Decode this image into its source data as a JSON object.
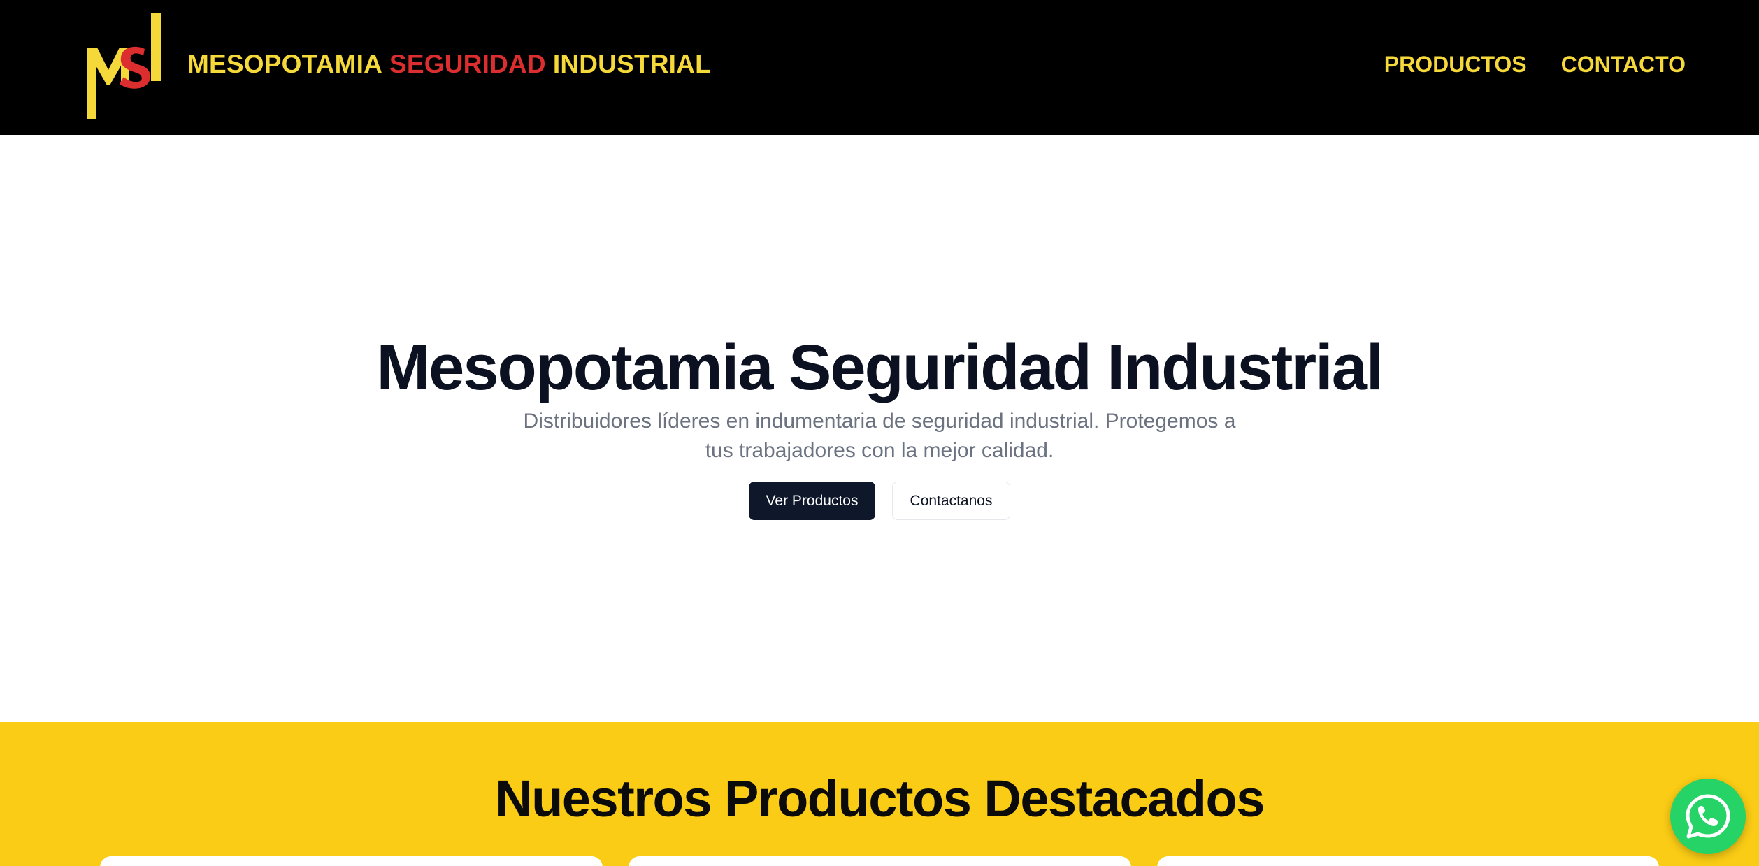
{
  "header": {
    "logo_alt": "MSI",
    "brand": {
      "part1": "MESOPOTAMIA",
      "part2": "SEGURIDAD",
      "part3": "INDUSTRIAL"
    },
    "nav": [
      {
        "label": "PRODUCTOS"
      },
      {
        "label": "CONTACTO"
      }
    ]
  },
  "hero": {
    "title": "Mesopotamia Seguridad Industrial",
    "subtitle": "Distribuidores líderes en indumentaria de seguridad industrial. Protegemos a tus trabajadores con la mejor calidad.",
    "primary_button": "Ver Productos",
    "secondary_button": "Contactanos"
  },
  "featured": {
    "title": "Nuestros Productos Destacados"
  },
  "floating": {
    "whatsapp_icon": "whatsapp-icon"
  },
  "colors": {
    "header_bg": "#000000",
    "brand_yellow": "#f5d83a",
    "brand_red": "#dc2e2e",
    "section_yellow": "#facc15",
    "primary_button": "#0f172a",
    "whatsapp_green": "#25d366"
  }
}
